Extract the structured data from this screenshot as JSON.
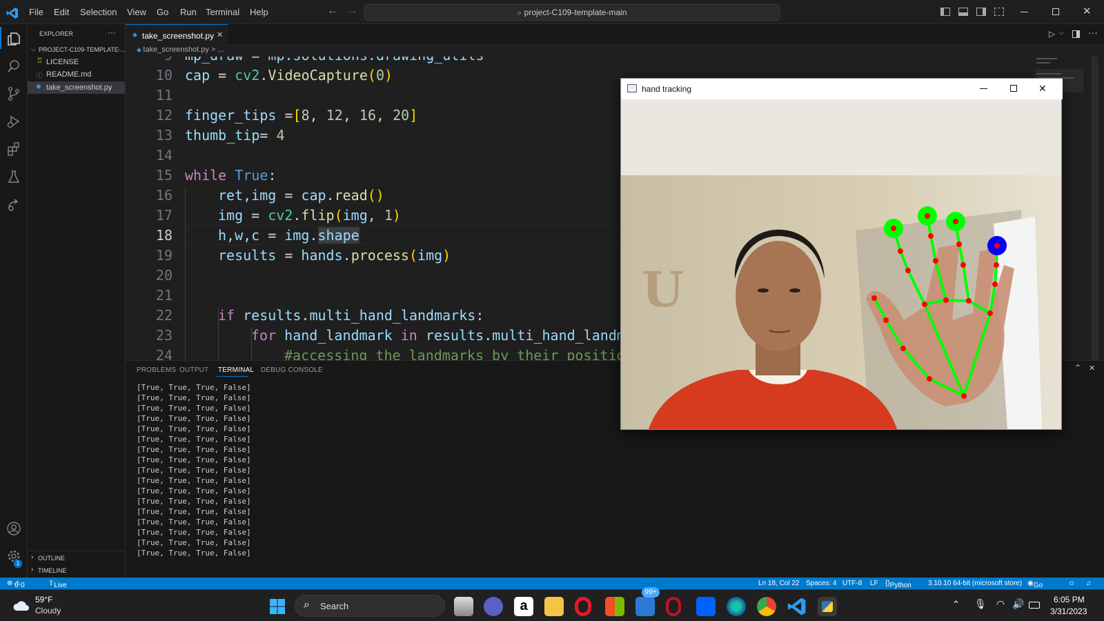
{
  "titlebar": {
    "menu": [
      "File",
      "Edit",
      "Selection",
      "View",
      "Go",
      "Run",
      "Terminal",
      "Help"
    ],
    "search": "project-C109-template-main"
  },
  "sidebar": {
    "title": "EXPLORER",
    "folder": "PROJECT-C109-TEMPLATE-...",
    "files": [
      "LICENSE",
      "README.md",
      "take_screenshot.py"
    ],
    "outline": "OUTLINE",
    "timeline": "TIMELINE"
  },
  "editor": {
    "tab": "take_screenshot.py",
    "breadcrumb": "take_screenshot.py > ...",
    "line_numbers": [
      "9",
      "10",
      "11",
      "12",
      "13",
      "14",
      "15",
      "16",
      "17",
      "18",
      "19",
      "20",
      "21",
      "22",
      "23",
      "24"
    ]
  },
  "code": {
    "l9": "mp_draw = mp.solutions.drawing_utils",
    "l10_a": "cap",
    "l10_b": " = ",
    "l10_c": "cv2",
    "l10_d": ".",
    "l10_e": "VideoCapture",
    "l10_f": "(",
    "l10_g": "0",
    "l10_h": ")",
    "l12_a": "finger_tips",
    "l12_b": " =",
    "l12_c": "[",
    "l12_d": "8",
    "l12_e": ", ",
    "l12_f": "12",
    "l12_g": "16",
    "l12_h": "20",
    "l12_i": "]",
    "l13_a": "thumb_tip",
    "l13_b": "= ",
    "l13_c": "4",
    "l15_a": "while",
    "l15_b": "True",
    "l15_c": ":",
    "l16_a": "ret,img",
    "l16_b": " = ",
    "l16_c": "cap",
    "l16_d": ".",
    "l16_e": "read",
    "l16_f": "()",
    "l17_a": "img",
    "l17_b": " = ",
    "l17_c": "cv2",
    "l17_d": ".",
    "l17_e": "flip",
    "l17_f": "(",
    "l17_g": "img, ",
    "l17_h": "1",
    "l17_i": ")",
    "l18_a": "h,w,c",
    "l18_b": " = ",
    "l18_c": "img",
    "l18_d": ".",
    "l18_e": "shape",
    "l19_a": "results",
    "l19_b": " = ",
    "l19_c": "hands",
    "l19_d": ".",
    "l19_e": "process",
    "l19_f": "(",
    "l19_g": "img",
    "l19_h": ")",
    "l22_a": "if",
    "l22_b": "results",
    "l22_c": ".",
    "l22_d": "multi_hand_landmarks",
    "l22_e": ":",
    "l23_a": "for",
    "l23_b": "hand_landmark",
    "l23_c": "in",
    "l23_d": "results",
    "l23_e": ".",
    "l23_f": "multi_hand_landm",
    "l24": "#accessing the landmarks by their positio"
  },
  "panel": {
    "tabs": [
      "PROBLEMS",
      "OUTPUT",
      "TERMINAL",
      "DEBUG CONSOLE"
    ],
    "lines": [
      "[True, True, True, False]",
      "[True, True, True, False]",
      "[True, True, True, False]",
      "[True, True, True, False]",
      "[True, True, True, False]",
      "[True, True, True, False]",
      "[True, True, True, False]",
      "[True, True, True, False]",
      "[True, True, True, False]",
      "[True, True, True, False]",
      "[True, True, True, False]",
      "[True, True, True, False]",
      "[True, True, True, False]",
      "[True, True, True, False]",
      "[True, True, True, False]",
      "[True, True, True, False]",
      "[True, True, True, False]"
    ]
  },
  "status": {
    "errors": "0",
    "warnings": "0",
    "liveshare": "Live Share",
    "position": "Ln 18, Col 22",
    "spaces": "Spaces: 4",
    "encoding": "UTF-8",
    "eol": "LF",
    "language": "Python",
    "interpreter": "3.10.10 64-bit (microsoft store)",
    "golive": "Go Live"
  },
  "cvwindow": {
    "title": "hand tracking"
  },
  "taskbar": {
    "temp": "59°F",
    "weather": "Cloudy",
    "search": "Search",
    "badge": "99+",
    "time": "6:05 PM",
    "date": "3/31/2023"
  },
  "colors": {
    "accent": "#007acc",
    "landmark": "#ff0000",
    "connection": "#00ff00",
    "thumb": "#0000ff"
  }
}
